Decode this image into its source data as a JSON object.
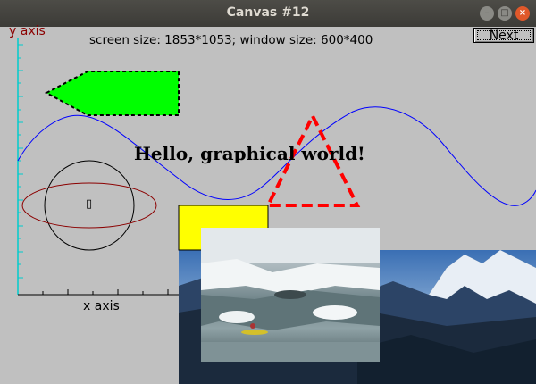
{
  "window": {
    "title": "Canvas #12",
    "controls": {
      "minimize": "–",
      "maximize": "□",
      "close": "×"
    }
  },
  "canvas": {
    "info": "screen size: 1853*1053; window size: 600*400",
    "next_label": "Next",
    "y_axis_label": "y axis",
    "x_axis_label": "x axis",
    "hello_text": "Hello, graphical world!",
    "ellipse_glyph": "▯"
  },
  "colors": {
    "axis": "#00cccc",
    "sine": "#0000ff",
    "arrow_fill": "#00ff00",
    "triangle": "#ff0000",
    "rect_fill": "#ffff00",
    "ellipse": "#8b0000",
    "circle": "#000000"
  },
  "images": {
    "background_photo": "mountain-landscape",
    "foreground_photo": "whitewater-kayaker"
  }
}
